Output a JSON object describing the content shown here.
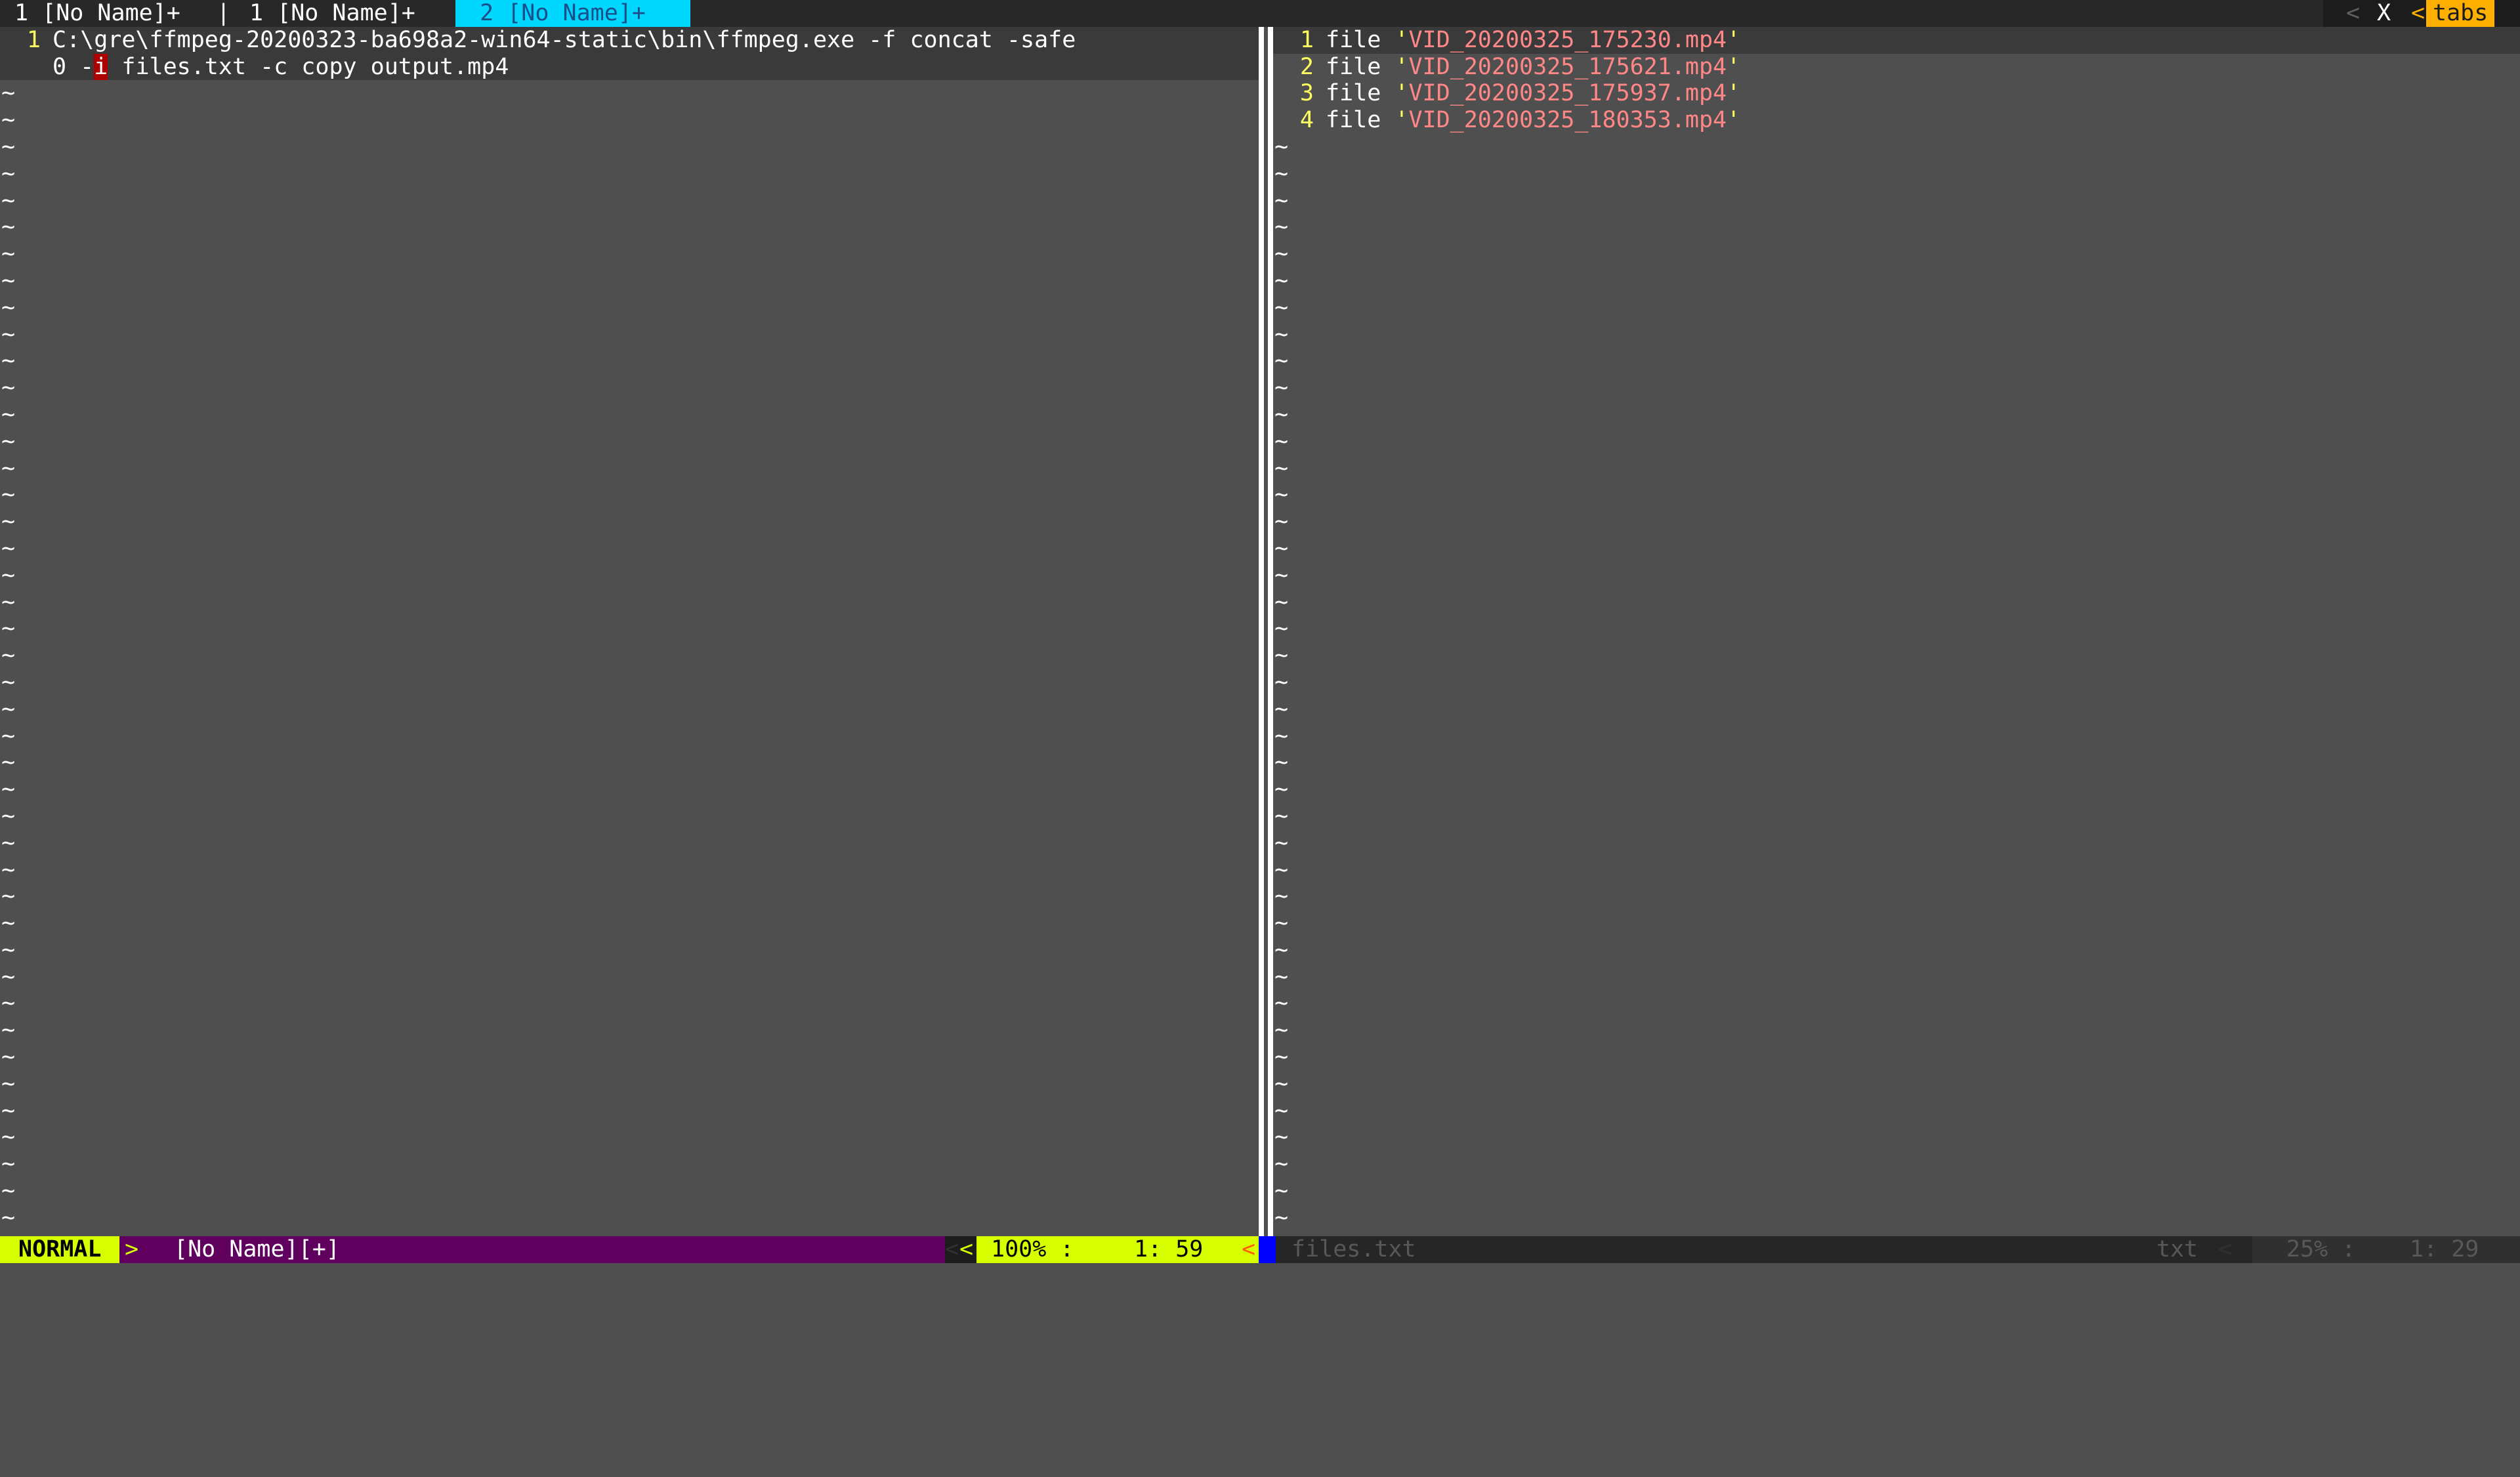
{
  "tabline": {
    "tabs": [
      {
        "label": "1 [No Name]+",
        "active": false
      },
      {
        "label": "1 [No Name]+",
        "active": false
      },
      {
        "label": " 2 [No Name]+",
        "active": true
      }
    ],
    "separator": "|",
    "close_label": "X",
    "tabs_label": "tabs"
  },
  "left_pane": {
    "line_number": "1",
    "line_text_1": "C:\\gre\\ffmpeg-20200323-ba698a2-win64-static\\bin\\ffmpeg.exe -f concat -safe",
    "line_text_2a": "0 -",
    "cursor_char": "i",
    "line_text_2b": " files.txt -c copy output.mp4",
    "tilde": "~"
  },
  "right_pane": {
    "lines": [
      {
        "num": "1",
        "keyword": "file",
        "q1": "'",
        "value": "VID_20200325_175230.mp4",
        "q2": "'"
      },
      {
        "num": "2",
        "keyword": "file",
        "q1": "'",
        "value": "VID_20200325_175621.mp4",
        "q2": "'"
      },
      {
        "num": "3",
        "keyword": "file",
        "q1": "'",
        "value": "VID_20200325_175937.mp4",
        "q2": "'"
      },
      {
        "num": "4",
        "keyword": "file",
        "q1": "'",
        "value": "VID_20200325_180353.mp4",
        "q2": "'"
      }
    ],
    "tilde": "~"
  },
  "statusline_left": {
    "mode": "NORMAL",
    "mode_sep": ">",
    "filename": "[No Name][+]",
    "sep_left": "<",
    "sep_left2": "<",
    "percent": "100% :",
    "position": "1: 59",
    "sep_right": "<"
  },
  "statusline_right": {
    "filename": "files.txt",
    "filetype": "txt",
    "sep": "<",
    "percent": "25% :",
    "position": "1: 29"
  },
  "colors": {
    "background": "#4f4f4f",
    "mode_bg": "#d7ff00",
    "active_tab_bg": "#00d7ff",
    "tabs_label_bg": "#ffaf00",
    "status_left_bg": "#5f005f",
    "string_color": "#ff8787",
    "line_number_color": "#ffff5f",
    "cursor_bg": "#af0000"
  }
}
